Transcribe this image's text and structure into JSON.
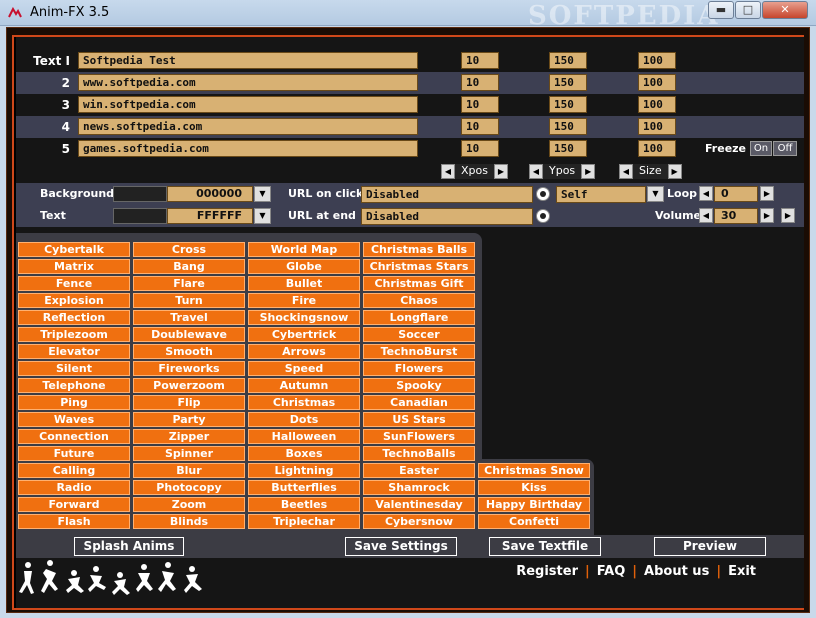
{
  "window": {
    "title": "Anim-FX 3.5",
    "watermark": "SOFTPEDIA",
    "minimize": "▬",
    "maximize": "□",
    "close": "✕"
  },
  "text_rows": [
    {
      "label": "Text I",
      "text": "Softpedia Test",
      "xpos": "10",
      "ypos": "150",
      "size": "100"
    },
    {
      "label": "2",
      "text": "www.softpedia.com",
      "xpos": "10",
      "ypos": "150",
      "size": "100"
    },
    {
      "label": "3",
      "text": "win.softpedia.com",
      "xpos": "10",
      "ypos": "150",
      "size": "100"
    },
    {
      "label": "4",
      "text": "news.softpedia.com",
      "xpos": "10",
      "ypos": "150",
      "size": "100"
    },
    {
      "label": "5",
      "text": "games.softpedia.com",
      "xpos": "10",
      "ypos": "150",
      "size": "100"
    }
  ],
  "freeze": {
    "label": "Freeze",
    "on": "On",
    "off": "Off"
  },
  "steppers": {
    "xpos": "Xpos",
    "ypos": "Ypos",
    "size": "Size"
  },
  "options": {
    "background_label": "Background",
    "background_value": "000000",
    "background_color": "#000000",
    "text_label": "Text",
    "text_value": "FFFFFF",
    "text_color": "#FFFFFF",
    "url_click_label": "URL on click",
    "url_click_value": "Disabled",
    "target_value": "Self",
    "url_end_label": "URL at end",
    "url_end_value": "Disabled",
    "loop_label": "Loop",
    "loop_value": "0",
    "volume_label": "Volume",
    "volume_value": "30"
  },
  "animations": {
    "col1": [
      "Cybertalk",
      "Matrix",
      "Fence",
      "Explosion",
      "Reflection",
      "Triplezoom",
      "Elevator",
      "Silent",
      "Telephone",
      "Ping",
      "Waves",
      "Connection",
      "Future",
      "Calling",
      "Radio",
      "Forward",
      "Flash"
    ],
    "col2": [
      "Cross",
      "Bang",
      "Flare",
      "Turn",
      "Travel",
      "Doublewave",
      "Smooth",
      "Fireworks",
      "Powerzoom",
      "Flip",
      "Party",
      "Zipper",
      "Spinner",
      "Blur",
      "Photocopy",
      "Zoom",
      "Blinds"
    ],
    "col3": [
      "World Map",
      "Globe",
      "Bullet",
      "Fire",
      "Shockingsnow",
      "Cybertrick",
      "Arrows",
      "Speed",
      "Autumn",
      "Christmas",
      "Dots",
      "Halloween",
      "Boxes",
      "Lightning",
      "Butterflies",
      "Beetles",
      "Triplechar"
    ],
    "col4": [
      "Christmas Balls",
      "Christmas Stars",
      "Christmas Gift",
      "Chaos",
      "Longflare",
      "Soccer",
      "TechnoBurst",
      "Flowers",
      "Spooky",
      "Canadian",
      "US Stars",
      "SunFlowers",
      "TechnoBalls",
      "Easter",
      "Shamrock",
      "Valentinesday",
      "Cybersnow"
    ],
    "col5": [
      "Christmas Snow",
      "Kiss",
      "Happy Birthday",
      "Confetti"
    ]
  },
  "buttons": {
    "splash": "Splash Anims",
    "save_settings": "Save Settings",
    "save_textfile": "Save Textfile",
    "preview": "Preview"
  },
  "footer": {
    "register": "Register",
    "faq": "FAQ",
    "about": "About us",
    "exit": "Exit",
    "sep": "|"
  },
  "colors": {
    "accent": "#f07010",
    "field": "#d8b173",
    "panel_row": "#3d3f52"
  }
}
